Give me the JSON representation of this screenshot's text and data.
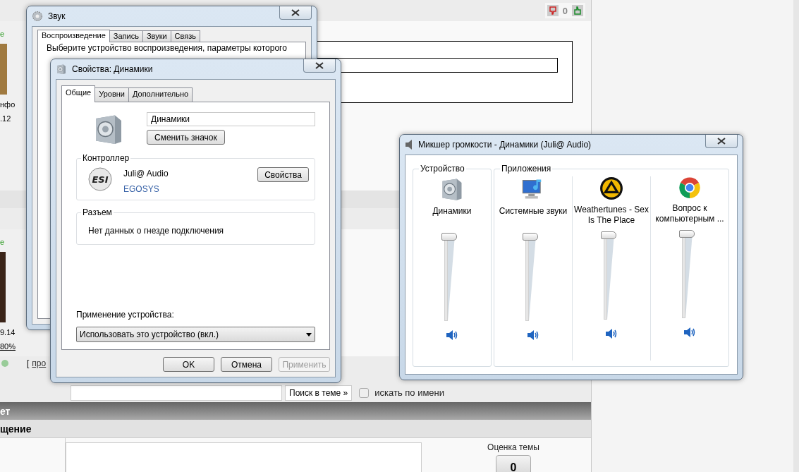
{
  "forum": {
    "vote": {
      "count": "0"
    },
    "posts": [
      {
        "status": "е",
        "info": "нфо",
        "date": ".12"
      },
      {
        "status": "е",
        "date": "9.14",
        "percent": "80%"
      }
    ],
    "footer": {
      "bracket": "[",
      "link": "про"
    },
    "search": {
      "button": "Поиск в теме »",
      "checkbox": {
        "label": "искать по имени",
        "checked": false
      }
    },
    "section_bar": "ет",
    "subsection_bar": "щение",
    "rating": {
      "label": "Оценка темы",
      "value": "0"
    }
  },
  "sound_window": {
    "title": "Звук",
    "tabs": [
      {
        "label": "Воспроизведение",
        "selected": true
      },
      {
        "label": "Запись",
        "selected": false
      },
      {
        "label": "Звуки",
        "selected": false
      },
      {
        "label": "Связь",
        "selected": false
      }
    ],
    "instructions": [
      "Выберите устройство воспроизведения, параметры которого"
    ]
  },
  "properties_window": {
    "title": "Свойства: Динамики",
    "tabs": [
      {
        "label": "Общие",
        "selected": true
      },
      {
        "label": "Уровни",
        "selected": false
      },
      {
        "label": "Дополнительно",
        "selected": false
      }
    ],
    "device_name": "Динамики",
    "change_icon_button": "Сменить значок",
    "controller": {
      "legend": "Контроллер",
      "logo_text": "ESI",
      "name": "Juli@ Audio",
      "vendor": "EGOSYS",
      "button": "Свойства"
    },
    "jack": {
      "legend": "Разъем",
      "text": "Нет данных о гнезде подключения"
    },
    "usage_label": "Применение устройства:",
    "usage_value": "Использовать это устройство (вкл.)",
    "buttons": [
      {
        "label": "OK",
        "disabled": false
      },
      {
        "label": "Отмена",
        "disabled": false
      },
      {
        "label": "Применить",
        "disabled": true
      }
    ]
  },
  "mixer_window": {
    "title": "Микшер громкости - Динамики (Juli@ Audio)",
    "device_group": {
      "legend": "Устройство",
      "channels": [
        {
          "name": "Динамики",
          "level": 1,
          "muted": false
        }
      ]
    },
    "apps_group": {
      "legend": "Приложения",
      "channels": [
        {
          "name": "Системные звуки",
          "level": 1,
          "muted": false
        },
        {
          "name": "Weathertunes - Sex Is The Place",
          "level": 1,
          "muted": false
        },
        {
          "name": "Вопрос к компьютерным ...",
          "level": 1,
          "muted": false
        }
      ]
    }
  }
}
